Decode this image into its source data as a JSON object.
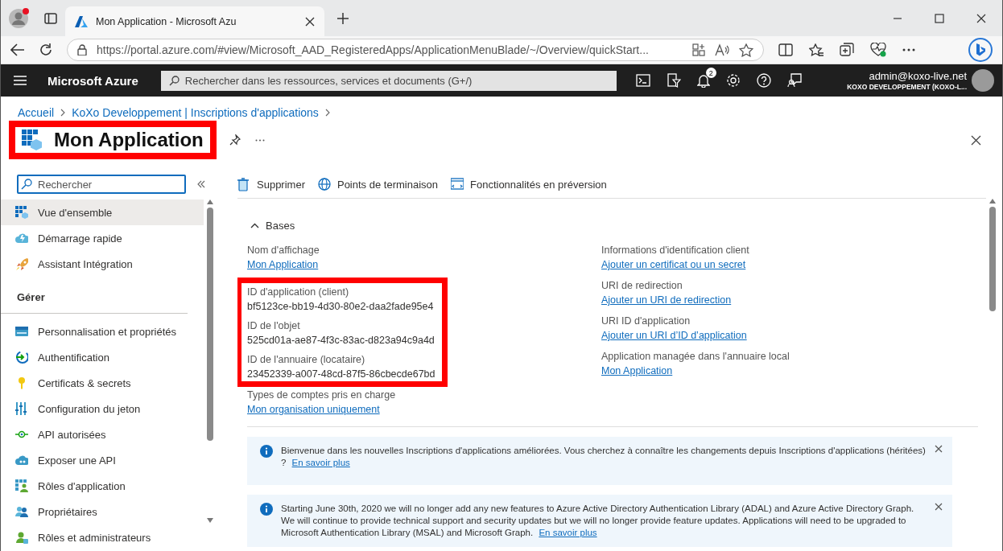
{
  "browser": {
    "tab_title": "Mon Application - Microsoft Azu",
    "url": "https://portal.azure.com/#view/Microsoft_AAD_RegisteredApps/ApplicationMenuBlade/~/Overview/quickStart..."
  },
  "portal_header": {
    "brand": "Microsoft Azure",
    "search_placeholder": "Rechercher dans les ressources, services et documents (G+/)",
    "notification_count": "2",
    "user": "admin@koxo-live.net",
    "tenant": "KOXO DEVELOPPEMENT (KOXO-L..."
  },
  "breadcrumb": [
    "Accueil",
    "KoXo Developpement | Inscriptions d'applications"
  ],
  "title": {
    "text": "Mon Application",
    "highlighted": true
  },
  "sidebar": {
    "search_placeholder": "Rechercher",
    "items": [
      {
        "kind": "item",
        "label": "Vue d'ensemble",
        "selected": true
      },
      {
        "kind": "item",
        "label": "Démarrage rapide",
        "selected": false
      },
      {
        "kind": "item",
        "label": "Assistant Intégration",
        "selected": false
      },
      {
        "kind": "header",
        "label": "Gérer"
      },
      {
        "kind": "item",
        "label": "Personnalisation et propriétés",
        "selected": false
      },
      {
        "kind": "item",
        "label": "Authentification",
        "selected": false
      },
      {
        "kind": "item",
        "label": "Certificats & secrets",
        "selected": false
      },
      {
        "kind": "item",
        "label": "Configuration du jeton",
        "selected": false
      },
      {
        "kind": "item",
        "label": "API autorisées",
        "selected": false
      },
      {
        "kind": "item",
        "label": "Exposer une API",
        "selected": false
      },
      {
        "kind": "item",
        "label": "Rôles d'application",
        "selected": false
      },
      {
        "kind": "item",
        "label": "Propriétaires",
        "selected": false
      },
      {
        "kind": "item",
        "label": "Rôles et administrateurs",
        "selected": false
      }
    ]
  },
  "toolbar": [
    "Supprimer",
    "Points de terminaison",
    "Fonctionnalités en préversion"
  ],
  "section": {
    "title": "Bases",
    "expanded": true
  },
  "left_fields": [
    {
      "label": "Nom d'affichage",
      "value": "Mon Application",
      "kind": "link",
      "highlighted": false
    },
    {
      "label": "ID d'application (client)",
      "value": "bf5123ce-bb19-4d30-80e2-daa2fade95e4",
      "kind": "text",
      "highlighted": true
    },
    {
      "label": "ID de l'objet",
      "value": "525cd01a-ae87-4f3c-83ac-d823a94c9a4d",
      "kind": "text",
      "highlighted": true
    },
    {
      "label": "ID de l'annuaire (locataire)",
      "value": "23452339-a007-48cd-87f5-86cbecde67bd",
      "kind": "text",
      "highlighted": true
    },
    {
      "label": "Types de comptes pris en charge",
      "value": "Mon organisation uniquement",
      "kind": "link",
      "highlighted": false
    }
  ],
  "right_fields": [
    {
      "label": "Informations d'identification client",
      "value": "Ajouter un certificat ou un secret",
      "kind": "link",
      "highlighted": false
    },
    {
      "label": "URI de redirection",
      "value": "Ajouter un URI de redirection",
      "kind": "link",
      "highlighted": false
    },
    {
      "label": "URI ID d'application",
      "value": "Ajouter un URI d’ID d’application",
      "kind": "link",
      "highlighted": false
    },
    {
      "label": "Application managée dans l'annuaire local",
      "value": "Mon Application",
      "kind": "link",
      "highlighted": false
    }
  ],
  "banners": [
    {
      "text": "Bienvenue dans les nouvelles Inscriptions d'applications améliorées. Vous cherchez à connaître les changements depuis Inscriptions d'applications (héritées) ?",
      "link": "En savoir plus"
    },
    {
      "text": "Starting June 30th, 2020 we will no longer add any new features to Azure Active Directory Authentication Library (ADAL) and Azure Active Directory Graph. We will continue to provide technical support and security updates but we will no longer provide feature updates. Applications will need to be upgraded to Microsoft Authentication Library (MSAL) and Microsoft Graph.",
      "link": "En savoir plus"
    }
  ]
}
